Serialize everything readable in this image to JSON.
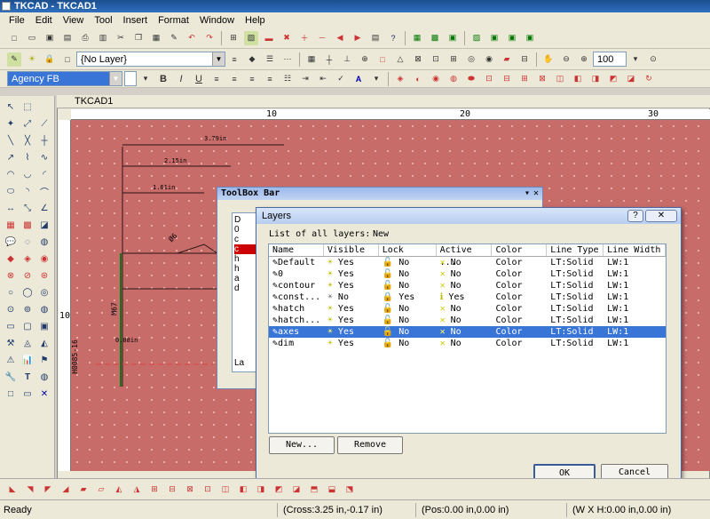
{
  "window": {
    "title": "TKCAD - TKCAD1"
  },
  "menu": [
    "File",
    "Edit",
    "View",
    "Tool",
    "Insert",
    "Format",
    "Window",
    "Help"
  ],
  "layer_combo": {
    "value": "{No Layer}"
  },
  "font_combo": {
    "value": "Agency FB"
  },
  "zoom_combo": {
    "value": "100"
  },
  "format_buttons": {
    "bold": "B",
    "italic": "I",
    "underline": "U",
    "font_color": "A"
  },
  "document_tab": {
    "label": "TKCAD1"
  },
  "ruler": {
    "h_ticks": [
      "10",
      "20",
      "30"
    ],
    "v_ticks": [
      "10"
    ]
  },
  "drawing": {
    "dim1": "3.79in",
    "dim2": "2.15in",
    "dim3": "1.61in",
    "dim4": "0.08in",
    "label_a": "Ø6",
    "label_b": "M67",
    "label_c": "H0085-16"
  },
  "toolbox_bar": {
    "title": "ToolBox Bar",
    "items": [
      "D",
      "0",
      "c",
      "c",
      "h",
      "h",
      "a",
      "d"
    ],
    "tab": "La"
  },
  "layers_dialog": {
    "title": "Layers",
    "list_label": "List of all layers:",
    "new_label": "New",
    "columns": [
      "Name",
      "Visible",
      "Lock",
      "Active ...",
      "Color",
      "Line Type",
      "Line Width"
    ],
    "rows": [
      {
        "name": "Default",
        "visible": "Yes",
        "lock": "No",
        "active": "No",
        "color": "Color",
        "linetype": "LT:Solid",
        "linewidth": "LW:1"
      },
      {
        "name": "0",
        "visible": "Yes",
        "lock": "No",
        "active": "No",
        "color": "Color",
        "linetype": "LT:Solid",
        "linewidth": "LW:1"
      },
      {
        "name": "contour",
        "visible": "Yes",
        "lock": "No",
        "active": "No",
        "color": "Color",
        "linetype": "LT:Solid",
        "linewidth": "LW:1"
      },
      {
        "name": "const...",
        "visible": "No",
        "lock": "Yes",
        "active": "Yes",
        "color": "Color",
        "linetype": "LT:Solid",
        "linewidth": "LW:1"
      },
      {
        "name": "hatch",
        "visible": "Yes",
        "lock": "No",
        "active": "No",
        "color": "Color",
        "linetype": "LT:Solid",
        "linewidth": "LW:1"
      },
      {
        "name": "hatch...",
        "visible": "Yes",
        "lock": "No",
        "active": "No",
        "color": "Color",
        "linetype": "LT:Solid",
        "linewidth": "LW:1"
      },
      {
        "name": "axes",
        "visible": "Yes",
        "lock": "No",
        "active": "No",
        "color": "Color",
        "linetype": "LT:Solid",
        "linewidth": "LW:1"
      },
      {
        "name": "dim",
        "visible": "Yes",
        "lock": "No",
        "active": "No",
        "color": "Color",
        "linetype": "LT:Solid",
        "linewidth": "LW:1"
      }
    ],
    "selected_row": 6,
    "buttons": {
      "new": "New...",
      "remove": "Remove",
      "ok": "OK",
      "cancel": "Cancel"
    }
  },
  "status": {
    "ready": "Ready",
    "cross": "(Cross:3.25 in,-0.17 in)",
    "pos": "(Pos:0.00 in,0.00 in)",
    "size": "(W X H:0.00 in,0.00 in)"
  },
  "colors": {
    "canvas": "#c86c6a",
    "selection": "#3875d7",
    "title_bar": "#1b4f8f"
  }
}
